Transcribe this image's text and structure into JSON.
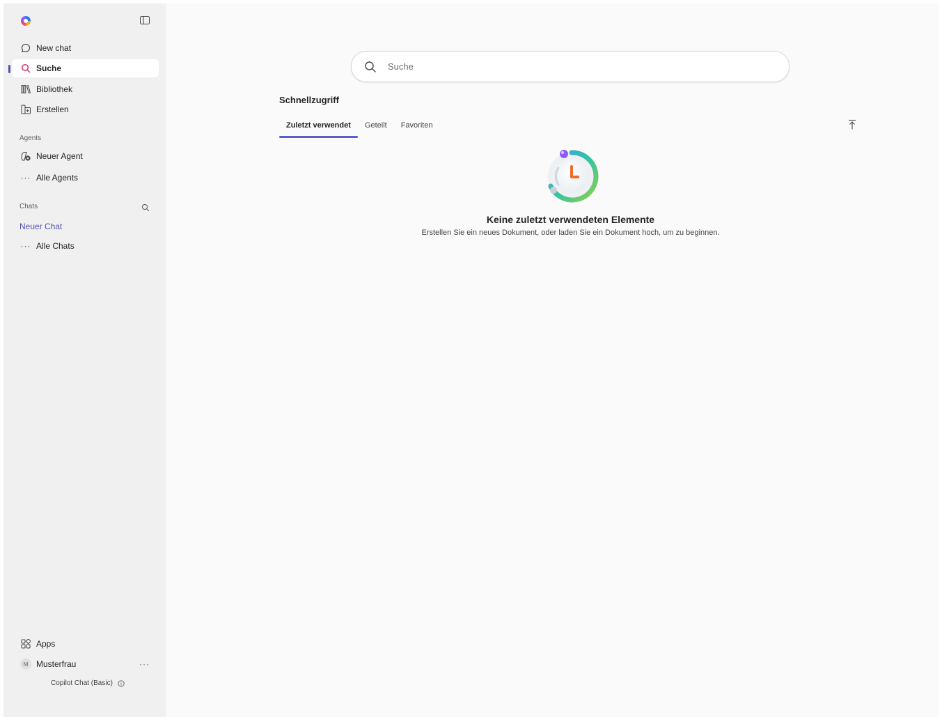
{
  "sidebar": {
    "nav": [
      {
        "label": "New chat",
        "icon": "chat-bubble-icon"
      },
      {
        "label": "Suche",
        "icon": "search-icon",
        "active": true
      },
      {
        "label": "Bibliothek",
        "icon": "library-icon"
      },
      {
        "label": "Erstellen",
        "icon": "create-icon"
      }
    ],
    "agents_section": "Agents",
    "agents": [
      {
        "label": "Neuer Agent",
        "icon": "new-agent-icon"
      },
      {
        "label": "Alle Agents",
        "icon": "more-icon"
      }
    ],
    "chats_section": "Chats",
    "new_chat_link": "Neuer Chat",
    "all_chats": "Alle Chats",
    "apps": "Apps",
    "user": {
      "initial": "M",
      "name": "Musterfrau"
    },
    "plan": "Copilot Chat (Basic)"
  },
  "main": {
    "search_placeholder": "Suche",
    "quick_access_title": "Schnellzugriff",
    "tabs": [
      {
        "label": "Zuletzt verwendet",
        "active": true
      },
      {
        "label": "Geteilt"
      },
      {
        "label": "Favoriten"
      }
    ],
    "empty_title": "Keine zuletzt verwendeten Elemente",
    "empty_desc": "Erstellen Sie ein neues Dokument, oder laden Sie ein Dokument hoch, um zu beginnen."
  },
  "colors": {
    "accent": "#4f52b2",
    "sidebar_bg": "#f0f0f0",
    "main_bg": "#fafafa"
  }
}
